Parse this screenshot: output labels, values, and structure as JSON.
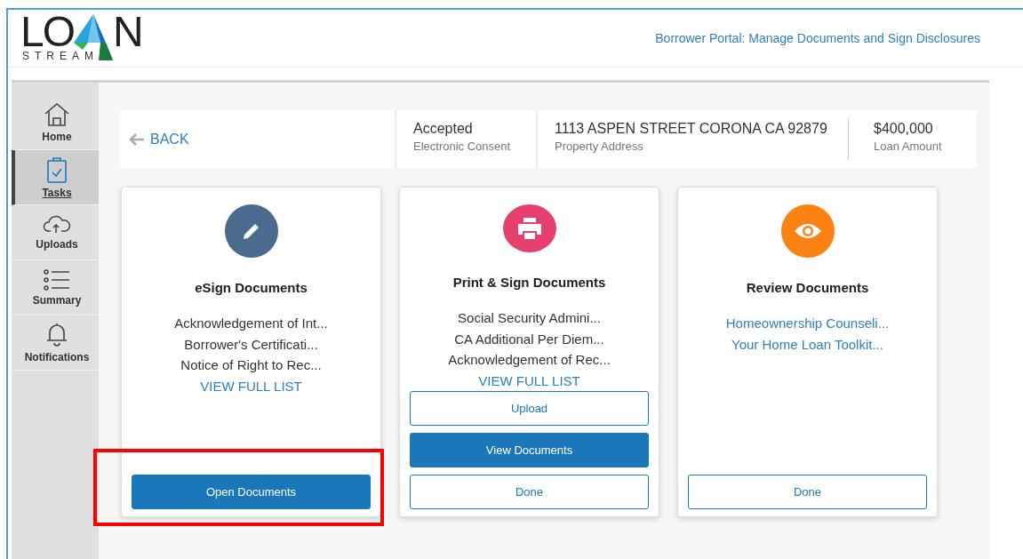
{
  "logo": {
    "text_left": "LO",
    "text_right": "N",
    "subtitle": "STREAM"
  },
  "header": {
    "title": "Borrower Portal: Manage Documents and Sign Disclosures"
  },
  "sidebar": {
    "items": [
      {
        "label": "Home",
        "selected": false
      },
      {
        "label": "Tasks",
        "selected": true
      },
      {
        "label": "Uploads",
        "selected": false
      },
      {
        "label": "Summary",
        "selected": false
      },
      {
        "label": "Notifications",
        "selected": false
      }
    ]
  },
  "info_bar": {
    "back": "BACK",
    "fields": [
      {
        "value": "Accepted",
        "label": "Electronic Consent"
      },
      {
        "value": "1113 ASPEN STREET CORONA CA 92879",
        "label": "Property Address"
      },
      {
        "value": "$400,000",
        "label": "Loan Amount"
      }
    ]
  },
  "cards": [
    {
      "title": "eSign Documents",
      "color": "#4a6a8e",
      "items": [
        {
          "kind": "text",
          "text": "Acknowledgement of Int..."
        },
        {
          "kind": "text",
          "text": "Borrower's Certificati..."
        },
        {
          "kind": "text",
          "text": "Notice of Right to Rec..."
        },
        {
          "kind": "link",
          "text": "VIEW FULL LIST"
        }
      ],
      "buttons": [
        {
          "kind": "filled",
          "label": "Open Documents"
        }
      ]
    },
    {
      "title": "Print & Sign Documents",
      "color": "#e8406e",
      "items": [
        {
          "kind": "text",
          "text": "Social Security Admini..."
        },
        {
          "kind": "text",
          "text": "CA Additional Per Diem..."
        },
        {
          "kind": "text",
          "text": "Acknowledgement of Rec..."
        },
        {
          "kind": "link",
          "text": "VIEW FULL LIST"
        }
      ],
      "buttons": [
        {
          "kind": "outline",
          "label": "Upload"
        },
        {
          "kind": "filled",
          "label": "View Documents"
        },
        {
          "kind": "outline",
          "label": "Done"
        }
      ]
    },
    {
      "title": "Review Documents",
      "color": "#fb8213",
      "items": [
        {
          "kind": "link",
          "text": "Homeownership Counseli..."
        },
        {
          "kind": "link",
          "text": "Your Home Loan Toolkit..."
        }
      ],
      "buttons": [
        {
          "kind": "outline",
          "label": "Done"
        }
      ]
    }
  ],
  "highlight": {
    "on": true
  }
}
